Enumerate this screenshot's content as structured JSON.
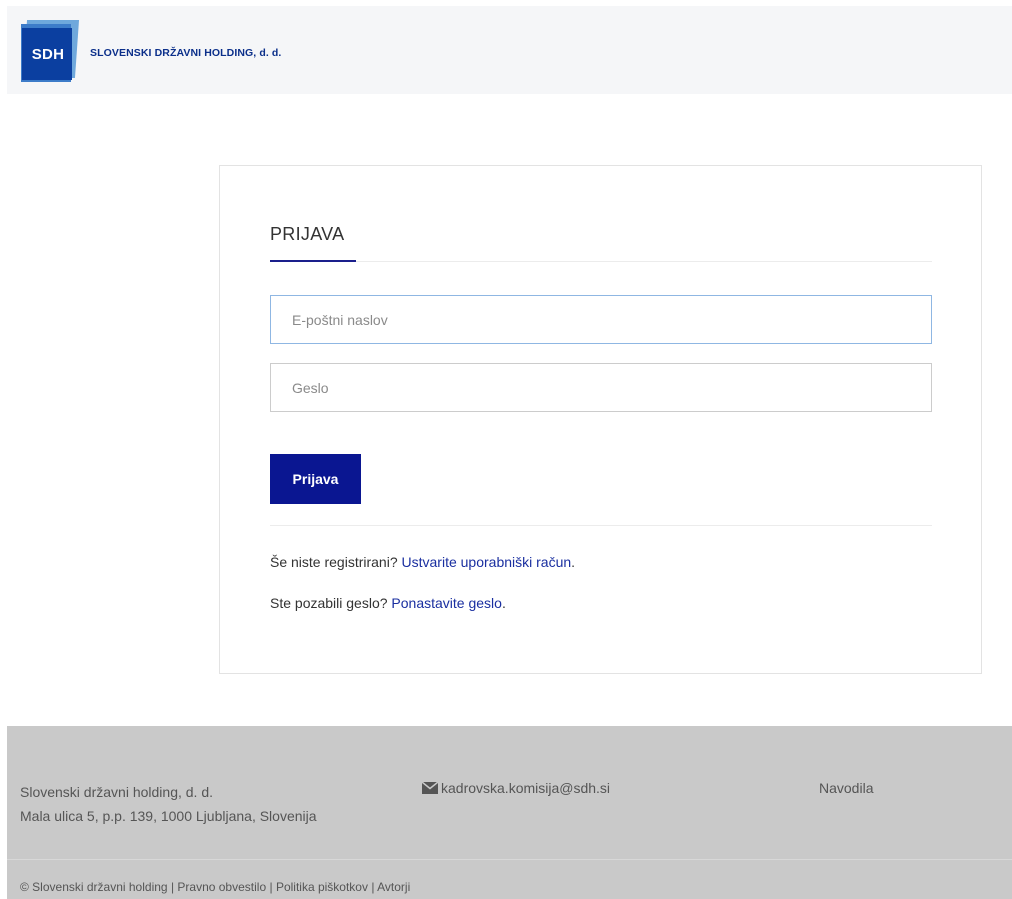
{
  "header": {
    "logo_text": "SDH",
    "company_name": "SLOVENSKI DRŽAVNI HOLDING, d. d."
  },
  "login": {
    "title": "PRIJAVA",
    "email_placeholder": "E-poštni naslov",
    "password_placeholder": "Geslo",
    "submit_label": "Prijava",
    "register_prompt": "Še niste registrirani?",
    "register_link": "Ustvarite uporabniški račun",
    "forgot_prompt": "Ste pozabili geslo?",
    "forgot_link": "Ponastavite geslo",
    "period": "."
  },
  "footer": {
    "company": "Slovenski državni holding, d. d.",
    "address": "Mala ulica 5, p.p. 139, 1000 Ljubljana, Slovenija",
    "email": "kadrovska.komisija@sdh.si",
    "help_link": "Navodila",
    "copyright": "© Slovenski državni holding",
    "divider": "|",
    "links": [
      "Pravno obvestilo",
      "Politika piškotkov",
      "Avtorji"
    ]
  },
  "colors": {
    "brand_blue": "#0a1691",
    "link_blue": "#1a2fa0",
    "footer_bg": "#c9c9c9",
    "header_bg": "#f5f6f8"
  },
  "icons": {
    "email": "envelope-icon"
  }
}
